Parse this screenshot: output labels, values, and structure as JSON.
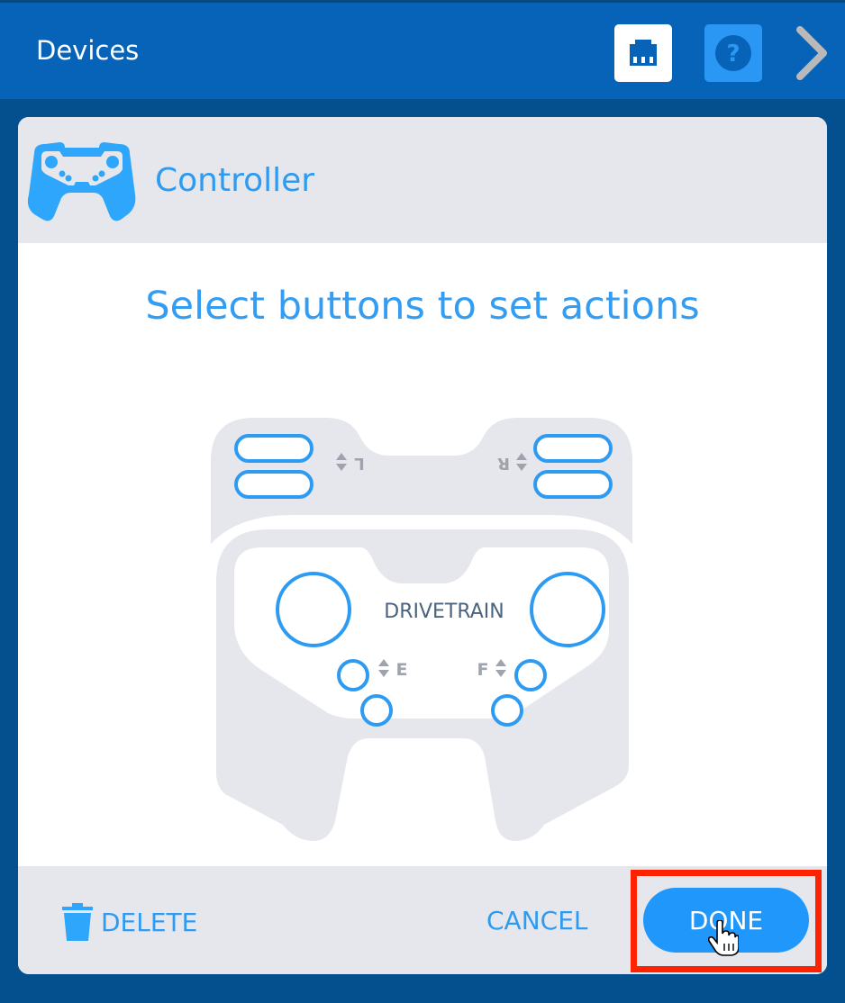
{
  "topbar": {
    "title": "Devices",
    "icons": {
      "port": "ethernet-port-icon",
      "help": "help-icon",
      "next": "chevron-right-icon"
    },
    "colors": {
      "bar": "#0763b8",
      "help_bg": "#2b97f5",
      "chevron": "#b9b9b9"
    }
  },
  "card": {
    "header": {
      "device_name": "Controller",
      "icon": "gamepad-icon"
    },
    "instruction": "Select buttons to set actions",
    "controller": {
      "left_bumper_label": "L",
      "right_bumper_label": "R",
      "center_label": "DRIVETRAIN",
      "left_button_group_label": "E",
      "right_button_group_label": "F",
      "buttons": [
        "L-up",
        "L-down",
        "R-up",
        "R-down",
        "left-joystick",
        "right-joystick",
        "E-up",
        "E-down",
        "F-up",
        "F-down"
      ]
    },
    "footer": {
      "delete_label": "DELETE",
      "cancel_label": "CANCEL",
      "done_label": "DONE"
    }
  },
  "colors": {
    "accent": "#2e9bf3",
    "done_bg": "#1f97fb",
    "panel_bg": "#e6e7ec",
    "background": "#04508f",
    "highlight": "#ff2200",
    "label_gray": "#9ea3ad",
    "drivetrain_text": "#4a6480"
  }
}
